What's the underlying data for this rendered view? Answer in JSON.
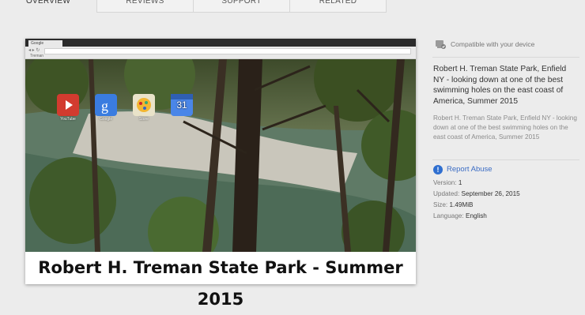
{
  "tabs": [
    {
      "label": "OVERVIEW",
      "active": true
    },
    {
      "label": "REVIEWS",
      "active": false
    },
    {
      "label": "SUPPORT",
      "active": false
    },
    {
      "label": "RELATED",
      "active": false
    }
  ],
  "preview": {
    "browser_tab_label": "Google",
    "bookmark_label": "Treman",
    "apps": [
      {
        "icon": "youtube-icon",
        "label": "YouTube"
      },
      {
        "icon": "google-search-icon",
        "label": "Google"
      },
      {
        "icon": "chrome-web-store-icon",
        "label": "Store"
      },
      {
        "icon": "calendar-icon",
        "label": "31"
      }
    ],
    "caption": "Robert H. Treman State Park - Summer 2015"
  },
  "details": {
    "compatible_text": "Compatible with your device",
    "title": "Robert H. Treman State Park, Enfield NY - looking down at one of the best swimming holes on the east coast of America, Summer 2015",
    "description": "Robert H. Treman State Park, Enfield NY - looking down at one of the best swimming holes on the east coast of America, Summer 2015",
    "report_abuse": "Report Abuse",
    "version_label": "Version:",
    "version_value": "1",
    "updated_label": "Updated:",
    "updated_value": "September 26, 2015",
    "size_label": "Size:",
    "size_value": "1.49MiB",
    "language_label": "Language:",
    "language_value": "English"
  },
  "colors": {
    "link": "#3b6cc4",
    "report_icon": "#2f6fd0"
  }
}
